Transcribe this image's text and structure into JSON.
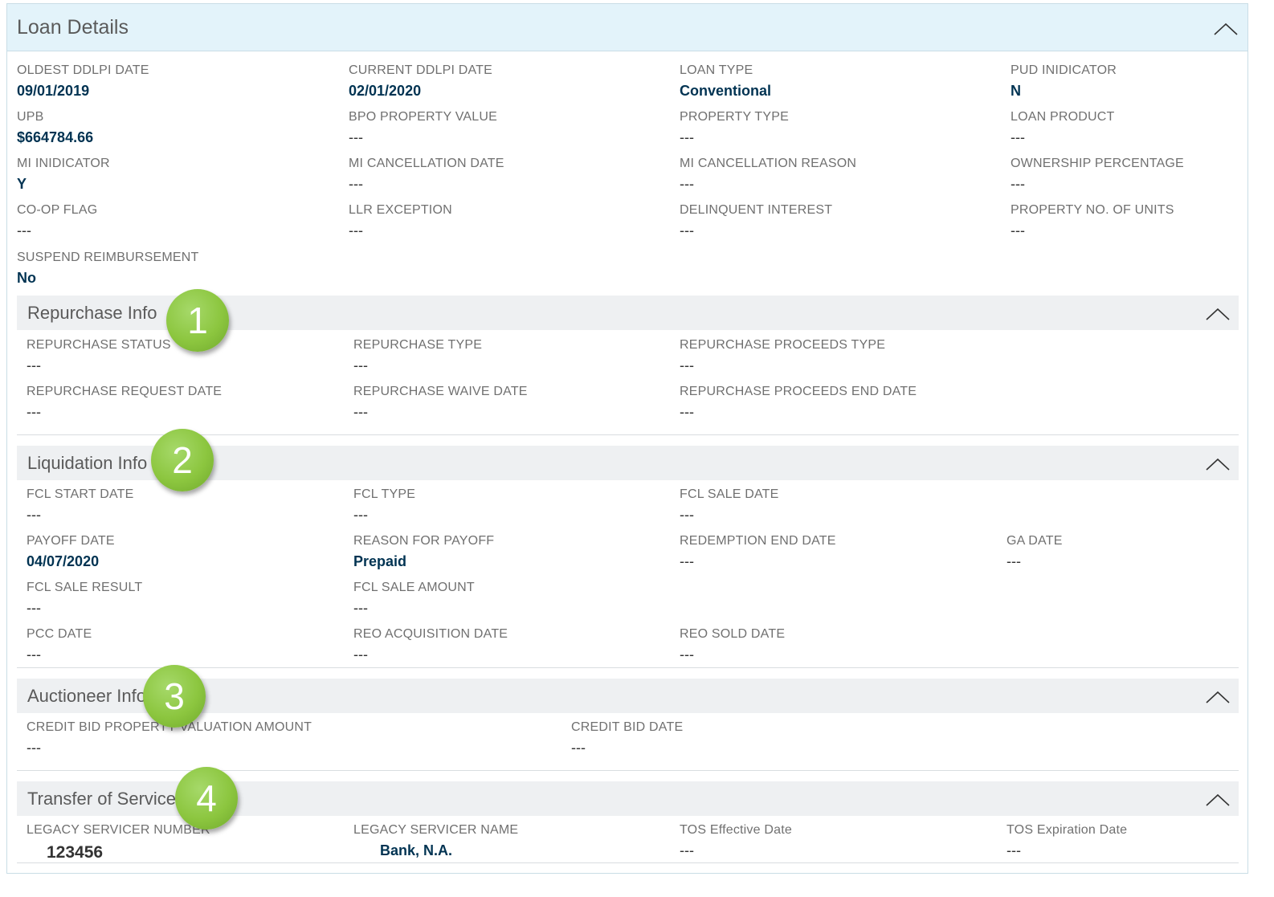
{
  "panel": {
    "title": "Loan Details"
  },
  "loan_fields": [
    {
      "label": "OLDEST DDLPI DATE",
      "value": "09/01/2019"
    },
    {
      "label": "CURRENT DDLPI DATE",
      "value": "02/01/2020"
    },
    {
      "label": "LOAN TYPE",
      "value": "Conventional"
    },
    {
      "label": "PUD INIDICATOR",
      "value": "N"
    },
    {
      "label": "UPB",
      "value": "$664784.66"
    },
    {
      "label": "BPO PROPERTY VALUE",
      "value": "---"
    },
    {
      "label": "PROPERTY TYPE",
      "value": "---"
    },
    {
      "label": "LOAN PRODUCT",
      "value": "---"
    },
    {
      "label": "MI INIDICATOR",
      "value": "Y"
    },
    {
      "label": "MI CANCELLATION DATE",
      "value": "---"
    },
    {
      "label": "MI CANCELLATION REASON",
      "value": "---"
    },
    {
      "label": "OWNERSHIP PERCENTAGE",
      "value": "---"
    },
    {
      "label": "CO-OP FLAG",
      "value": "---"
    },
    {
      "label": "LLR EXCEPTION",
      "value": "---"
    },
    {
      "label": "DELINQUENT INTEREST",
      "value": "---"
    },
    {
      "label": "PROPERTY NO. OF UNITS",
      "value": "---"
    },
    {
      "label": "SUSPEND REIMBURSEMENT",
      "value": "No"
    }
  ],
  "repurchase": {
    "title": "Repurchase Info",
    "badge": "1",
    "fields": [
      {
        "label": "REPURCHASE STATUS",
        "value": "---"
      },
      {
        "label": "REPURCHASE TYPE",
        "value": "---"
      },
      {
        "label": "REPURCHASE PROCEEDS TYPE",
        "value": "---"
      },
      {
        "label": "REPURCHASE REQUEST DATE",
        "value": "---"
      },
      {
        "label": "REPURCHASE WAIVE DATE",
        "value": "---"
      },
      {
        "label": "REPURCHASE PROCEEDS END DATE",
        "value": "---"
      }
    ]
  },
  "liquidation": {
    "title": "Liquidation Info",
    "badge": "2",
    "fields": [
      {
        "label": "FCL START DATE",
        "value": "---"
      },
      {
        "label": "FCL TYPE",
        "value": "---"
      },
      {
        "label": "FCL SALE DATE",
        "value": "---"
      },
      {
        "label": "PAYOFF DATE",
        "value": "04/07/2020"
      },
      {
        "label": "REASON FOR PAYOFF",
        "value": "Prepaid"
      },
      {
        "label": "REDEMPTION END DATE",
        "value": "---"
      },
      {
        "label": "GA DATE",
        "value": "---"
      },
      {
        "label": "FCL SALE RESULT",
        "value": "---"
      },
      {
        "label": "FCL SALE AMOUNT",
        "value": "---"
      },
      {
        "label": "PCC DATE",
        "value": "---"
      },
      {
        "label": "REO ACQUISITION DATE",
        "value": "---"
      },
      {
        "label": "REO SOLD DATE",
        "value": "---"
      }
    ]
  },
  "auctioneer": {
    "title": "Auctioneer Info",
    "badge": "3",
    "fields": [
      {
        "label": "CREDIT BID PROPERTY VALUATION AMOUNT",
        "value": "---"
      },
      {
        "label": "CREDIT BID DATE",
        "value": "---"
      }
    ]
  },
  "transfer": {
    "title": "Transfer of Servicer",
    "badge": "4",
    "fields": [
      {
        "label": "LEGACY SERVICER NUMBER",
        "value": "123456"
      },
      {
        "label": "LEGACY SERVICER NAME",
        "value": "Bank, N.A."
      },
      {
        "label": "TOS Effective Date",
        "value": "---"
      },
      {
        "label": "TOS Expiration Date",
        "value": "---"
      }
    ]
  }
}
